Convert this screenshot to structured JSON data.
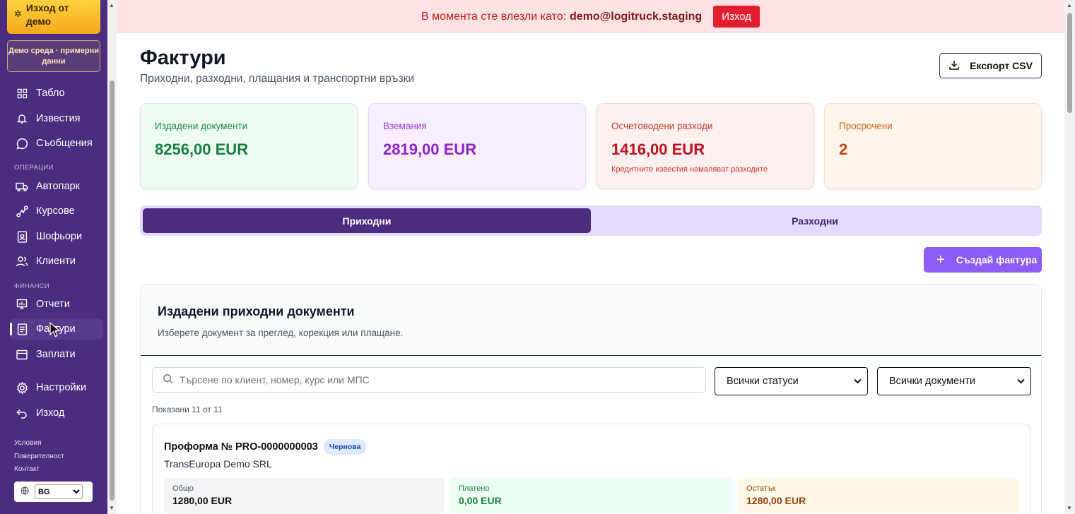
{
  "sidebar": {
    "demo_exit": "Изход от демо",
    "demo_env": "Демо среда · примерни данни",
    "items": [
      {
        "label": "Табло",
        "icon": "grid-icon"
      },
      {
        "label": "Известия",
        "icon": "bell-icon"
      },
      {
        "label": "Съобщения",
        "icon": "chat-icon"
      },
      {
        "label": "Автопарк",
        "icon": "truck-icon"
      },
      {
        "label": "Курсове",
        "icon": "route-icon"
      },
      {
        "label": "Шофьори",
        "icon": "id-badge-icon"
      },
      {
        "label": "Клиенти",
        "icon": "users-icon"
      },
      {
        "label": "Отчети",
        "icon": "chart-icon"
      },
      {
        "label": "Фактури",
        "icon": "receipt-icon"
      },
      {
        "label": "Заплати",
        "icon": "wallet-icon"
      },
      {
        "label": "Настройки",
        "icon": "gear-icon"
      },
      {
        "label": "Изход",
        "icon": "logout-icon"
      }
    ],
    "section_operations": "ОПЕРАЦИИ",
    "section_finance": "ФИНАНСИ",
    "footer": {
      "terms": "Условия",
      "privacy": "Поверителност",
      "contact": "Контакт"
    },
    "language": "BG"
  },
  "banner": {
    "text": "В момента сте влезли като:",
    "email": "demo@logitruck.staging",
    "exit_label": "Изход"
  },
  "header": {
    "title": "Фактури",
    "subtitle": "Приходни, разходни, плащания и транспортни връзки",
    "export_label": "Експорт CSV"
  },
  "stats": [
    {
      "label": "Издадени документи",
      "value": "8256,00 EUR",
      "note": ""
    },
    {
      "label": "Вземания",
      "value": "2819,00 EUR",
      "note": ""
    },
    {
      "label": "Осчетоводени разходи",
      "value": "1416,00 EUR",
      "note": "Кредитните известия намаляват разходите"
    },
    {
      "label": "Просрочени",
      "value": "2",
      "note": ""
    }
  ],
  "tabs": {
    "income": "Приходни",
    "expense": "Разходни"
  },
  "create_label": "Създай фактура",
  "panel": {
    "title": "Издадени приходни документи",
    "subtitle": "Изберете документ за преглед, корекция или плащане.",
    "search_placeholder": "Търсене по клиент, номер, курс или МПС",
    "status_filter": "Всички статуси",
    "doc_filter": "Всички документи",
    "shown": "Показани 11 от 11"
  },
  "documents": [
    {
      "title": "Проформа № PRO-0000000003",
      "status": "Чернова",
      "client": "TransEuropa Demo SRL",
      "total_label": "Общо",
      "total": "1280,00 EUR",
      "paid_label": "Платено",
      "paid": "0,00 EUR",
      "remaining_label": "Остатък",
      "remaining": "1280,00 EUR"
    }
  ]
}
